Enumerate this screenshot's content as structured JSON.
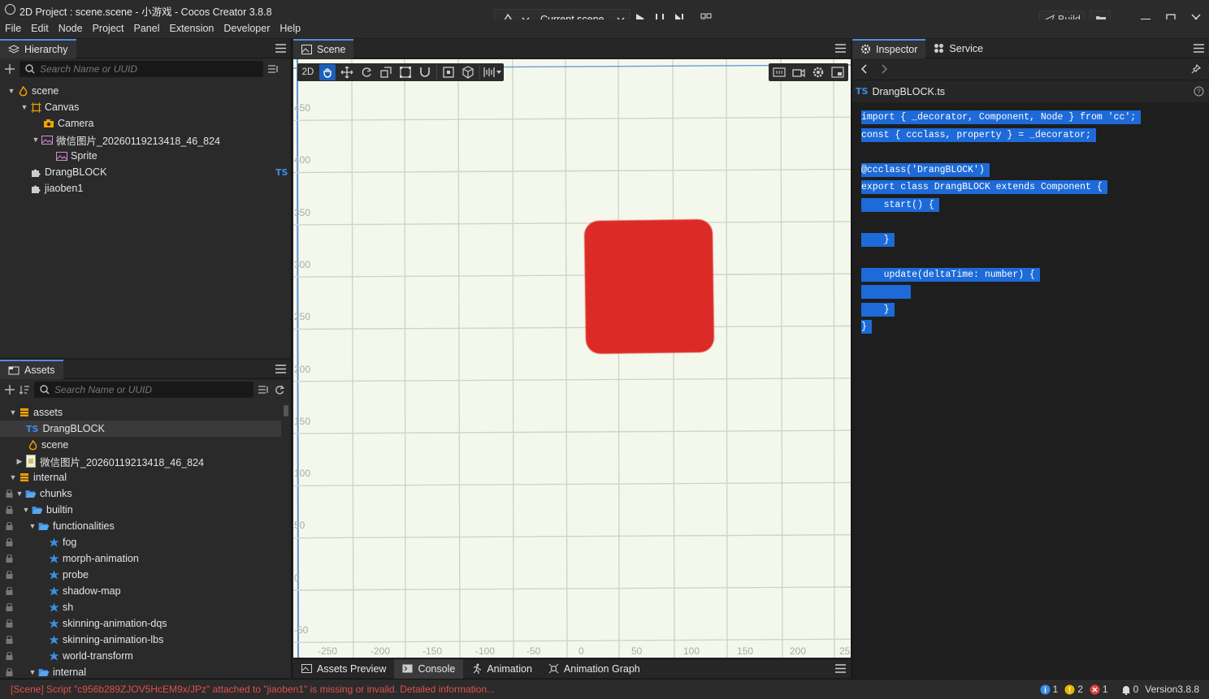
{
  "window": {
    "title": "2D Project : scene.scene - 小游戏 - Cocos Creator 3.8.8",
    "scene_selector": "Current scene",
    "build_label": "Build"
  },
  "menu": [
    "File",
    "Edit",
    "Node",
    "Project",
    "Panel",
    "Extension",
    "Developer",
    "Help"
  ],
  "hierarchy": {
    "tab": "Hierarchy",
    "search_placeholder": "Search Name or UUID",
    "items": [
      {
        "label": "scene"
      },
      {
        "label": "Canvas"
      },
      {
        "label": "Camera"
      },
      {
        "label": "微信图片_20260119213418_46_824"
      },
      {
        "label": "Sprite"
      },
      {
        "label": "DrangBLOCK",
        "badge": "TS"
      },
      {
        "label": "jiaoben1"
      }
    ]
  },
  "assets": {
    "tab": "Assets",
    "search_placeholder": "Search Name or UUID",
    "items": [
      {
        "label": "assets"
      },
      {
        "label": "DrangBLOCK",
        "prefix": "TS"
      },
      {
        "label": "scene"
      },
      {
        "label": "微信图片_20260119213418_46_824"
      },
      {
        "label": "internal"
      },
      {
        "label": "chunks"
      },
      {
        "label": "builtin"
      },
      {
        "label": "functionalities"
      },
      {
        "label": "fog"
      },
      {
        "label": "morph-animation"
      },
      {
        "label": "probe"
      },
      {
        "label": "shadow-map"
      },
      {
        "label": "sh"
      },
      {
        "label": "skinning-animation-dqs"
      },
      {
        "label": "skinning-animation-lbs"
      },
      {
        "label": "world-transform"
      },
      {
        "label": "internal"
      }
    ]
  },
  "scene": {
    "tab": "Scene",
    "mode_label": "2D",
    "y_ticks": [
      "450",
      "400",
      "350",
      "300",
      "250",
      "200",
      "150",
      "100",
      "50",
      "0",
      "-50"
    ],
    "x_ticks": [
      "-250",
      "-200",
      "-150",
      "-100",
      "-50",
      "0",
      "50",
      "100",
      "150",
      "200",
      "25"
    ],
    "block_color": "#dc2b26",
    "bg_color": "#f4f8ec"
  },
  "bottom_tabs": [
    "Assets Preview",
    "Console",
    "Animation",
    "Animation Graph"
  ],
  "inspector": {
    "tabs": [
      "Inspector",
      "Service"
    ],
    "file_prefix": "TS",
    "file_name": "DrangBLOCK.ts",
    "code_lines": [
      "import { _decorator, Component, Node } from 'cc';",
      "const { ccclass, property } = _decorator;",
      "",
      "@ccclass('DrangBLOCK')",
      "export class DrangBLOCK extends Component {",
      "    start() {",
      "",
      "    }",
      "",
      "    update(deltaTime: number) {",
      "        ",
      "    }",
      "}"
    ]
  },
  "status": {
    "message": "[Scene] Script \"c956b289ZJOV5HcEM9x/JPz\" attached to \"jiaoben1\" is missing or invalid. Detailed information...",
    "info_count": "1",
    "warn_count": "2",
    "error_count": "1",
    "notif_count": "0",
    "version": "Version3.8.8"
  }
}
